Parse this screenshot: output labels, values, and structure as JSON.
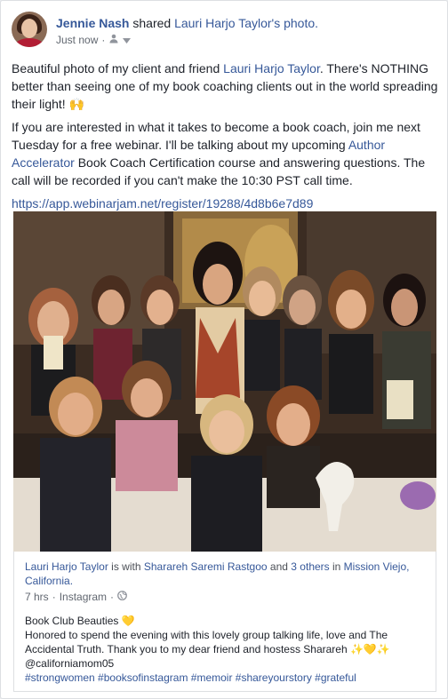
{
  "post": {
    "author": "Jennie Nash",
    "shared_text": "shared",
    "source_link": "Lauri Harjo Taylor's photo.",
    "time": "Just now",
    "separator": "·",
    "paragraph1_a": "Beautiful photo of my client and friend ",
    "paragraph1_link": "Lauri Harjo Taylor",
    "paragraph1_b": ". There's NOTHING better than seeing one of my book coaching clients out in the world spreading their light! ",
    "paragraph1_emoji": "🙌",
    "paragraph2_a": "If you are interested in what it takes to become a book coach, join me next Tuesday for a free webinar. I'll be talking about my upcoming ",
    "paragraph2_link": "Author Accelerator",
    "paragraph2_b": " Book Coach Certification course and answering questions. The call will be recorded if you can't make the 10:30 PST call time.",
    "url": "https://app.webinarjam.net/register/19288/4d8b6e7d89"
  },
  "shared_post": {
    "author": "Lauri Harjo Taylor",
    "is_with": " is with ",
    "with_person": "Sharareh Saremi Rastgoo",
    "and": " and ",
    "others": "3 others",
    "in": " in ",
    "location": "Mission Viejo, California.",
    "time": "7 hrs",
    "separator": "·",
    "source": "Instagram",
    "title": "Book Club Beauties 💛",
    "description": "Honored to spend the evening with this lovely group talking life, love and The Accidental Truth. Thank you to my dear friend and hostess Sharareh ✨💛✨ @californiamom05",
    "hashtags": "#strongwomen #booksofinstagram #memoir #shareyourstory #grateful"
  },
  "colors": {
    "link": "#365899",
    "text": "#1d2129",
    "meta": "#616770"
  }
}
